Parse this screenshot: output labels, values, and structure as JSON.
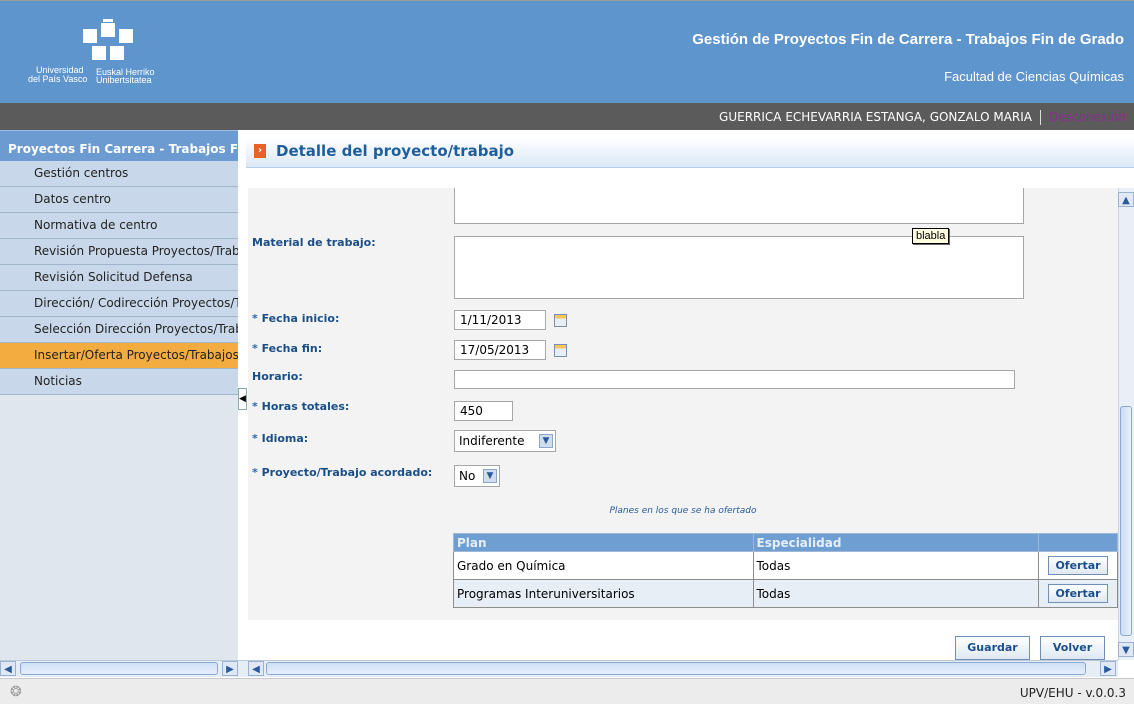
{
  "header": {
    "logo_line1": "Universidad",
    "logo_line2": "del País Vasco",
    "logo_line3": "Euskal Herriko",
    "logo_line4": "Unibertsitatea",
    "app_title": "Gestión de Proyectos Fin de Carrera - Trabajos Fin de Grado",
    "faculty": "Facultad de Ciencias Químicas"
  },
  "userbar": {
    "user_name": "GUERRICA ECHEVARRIA ESTANGA, GONZALO MARIA",
    "logout_label": "Desconexión"
  },
  "sidebar": {
    "header": "Proyectos Fin Carrera - Trabajos Fin de Grado",
    "items": [
      {
        "label": "Gestión centros",
        "active": false
      },
      {
        "label": "Datos centro",
        "active": false
      },
      {
        "label": "Normativa de centro",
        "active": false
      },
      {
        "label": "Revisión Propuesta Proyectos/Trabajos",
        "active": false
      },
      {
        "label": "Revisión Solicitud Defensa",
        "active": false
      },
      {
        "label": "Dirección/ Codirección Proyectos/Trabajos",
        "active": false
      },
      {
        "label": "Selección Dirección Proyectos/Trabajos",
        "active": false
      },
      {
        "label": "Insertar/Oferta Proyectos/Trabajos",
        "active": true
      },
      {
        "label": "Noticias",
        "active": false
      }
    ]
  },
  "content": {
    "title": "Detalle del proyecto/trabajo"
  },
  "form": {
    "material_label": "Material de trabajo:",
    "fecha_inicio_label": "Fecha inicio:",
    "fecha_inicio_value": "1/11/2013",
    "fecha_fin_label": "Fecha fin:",
    "fecha_fin_value": "17/05/2013",
    "horario_label": "Horario:",
    "horario_value": "",
    "horas_label": "Horas totales:",
    "horas_value": "450",
    "idioma_label": "Idioma:",
    "idioma_value": "Indiferente",
    "acordado_label": "Proyecto/Trabajo acordado:",
    "acordado_value": "No",
    "required_mark": "*"
  },
  "tooltip": "blabla",
  "planes": {
    "caption": "Planes en los que se ha ofertado",
    "headers": [
      "Plan",
      "Especialidad",
      ""
    ],
    "rows": [
      {
        "plan": "Grado en Química",
        "especialidad": "Todas",
        "action": "Ofertar"
      },
      {
        "plan": "Programas Interuniversitarios",
        "especialidad": "Todas",
        "action": "Ofertar"
      }
    ]
  },
  "buttons": {
    "save": "Guardar",
    "back": "Volver"
  },
  "footer": {
    "version": "UPV/EHU - v.0.0.3"
  },
  "colors": {
    "header_bg": "#5f95cd",
    "userbar_bg": "#5b5b5b",
    "sidebar_active": "#f3ac3f",
    "title_color": "#1f5e9c"
  }
}
